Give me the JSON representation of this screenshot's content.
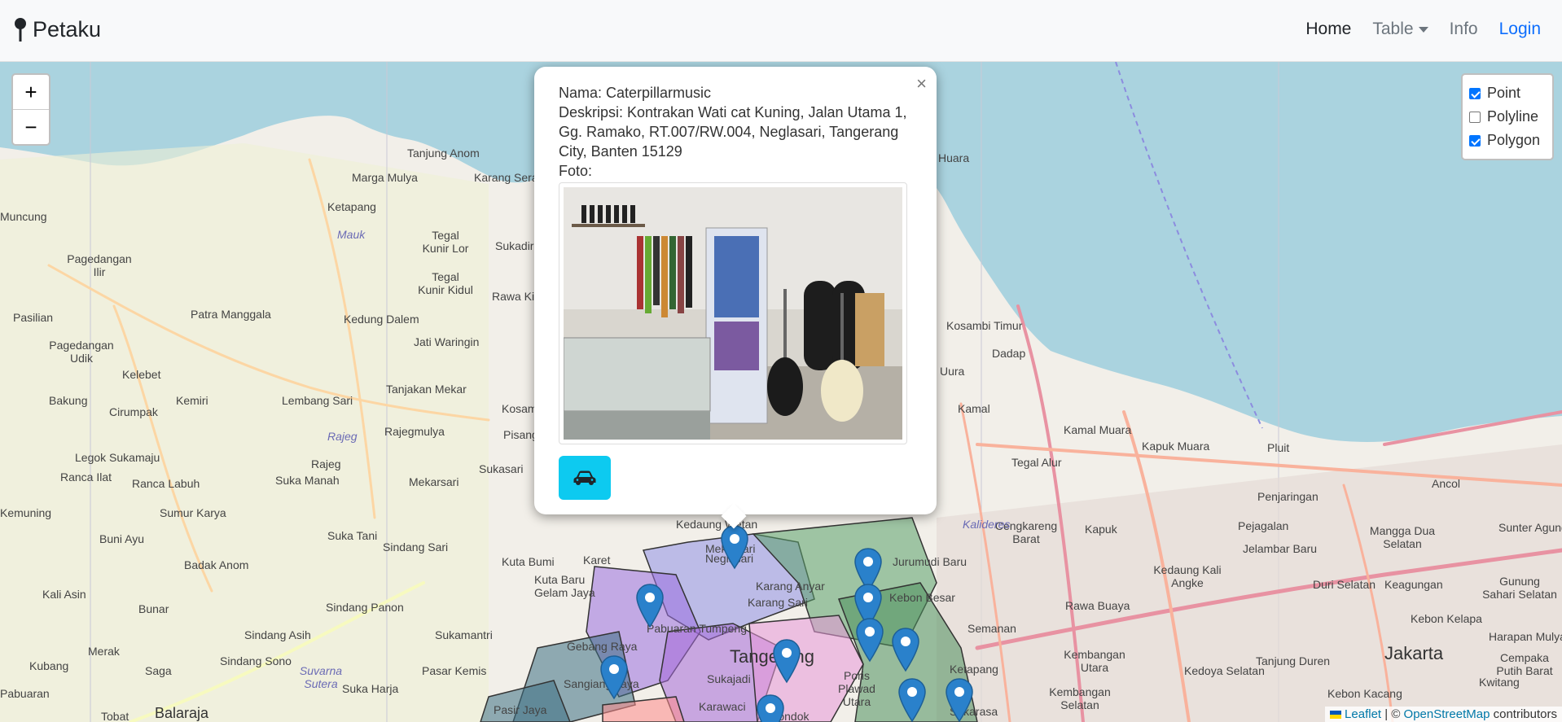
{
  "navbar": {
    "brand": "Petaku",
    "links": {
      "home": "Home",
      "table": "Table",
      "info": "Info",
      "login": "Login"
    }
  },
  "zoom": {
    "in": "+",
    "out": "−"
  },
  "layers": {
    "point": {
      "label": "Point",
      "checked": true
    },
    "polyline": {
      "label": "Polyline",
      "checked": false
    },
    "polygon": {
      "label": "Polygon",
      "checked": true
    }
  },
  "popup": {
    "close": "×",
    "nama": "Nama: Caterpillarmusic",
    "deskripsi": "Deskripsi: Kontrakan Wati cat Kuning, Jalan Utama 1, Gg. Ramako, RT.007/RW.004, Neglasari, Tangerang City, Banten 15129",
    "foto": "Foto:",
    "route_icon": "car-icon"
  },
  "places": [
    "Tanjung Anom",
    "Marga Mulya",
    "Karang Serang",
    "Ketapang",
    "Mauk",
    "Muncung",
    "Pagedangan Ilir",
    "Tegal Kunir Lor",
    "Tegal Kunir Kidul",
    "Sukadiri",
    "Rawa Kidang",
    "Pasilian",
    "Patra Manggala",
    "Kedung Dalem",
    "Jati Waringin",
    "Pagedangan Udik",
    "Kelebet",
    "Tanjakan Mekar",
    "Bakung",
    "Cirumpak",
    "Kemiri",
    "Lembang Sari",
    "Kosambi",
    "Rajeg",
    "Rajegmulya",
    "Pisangan",
    "Legok Sukamaju",
    "Rajeg",
    "Suka Manah",
    "Sukasari",
    "Ranca Ilat",
    "Ranca Labuh",
    "Mekarsari",
    "Kemuning",
    "Sumur Karya",
    "Buni Ayu",
    "Suka Tani",
    "Sindang Sari",
    "Badak Anom",
    "Kuta Bumi",
    "Kuta Baru",
    "Karet",
    "Kali Asin",
    "Bunar",
    "Sindang Panon",
    "Gelam Jaya",
    "Sindang Asih",
    "Sukamantri",
    "Merak",
    "Kubang",
    "Sindang Sono",
    "Pasar Kemis",
    "Saga",
    "Suvarna Sutera",
    "Suka Harja",
    "Pabuaran",
    "Tobat",
    "Balaraja",
    "Pasir Jaya",
    "Kosambi Timur",
    "Dadap",
    "Kamal",
    "Kamal Muara",
    "Tegal Alur",
    "Kapuk Muara",
    "Pluit",
    "Ancol",
    "Cengkareng Barat",
    "Kapuk",
    "Penjaringan",
    "Pejagalan",
    "Jelambar Baru",
    "Mangga Dua Selatan",
    "Sunter Agung",
    "Kedaung Kali Angke",
    "Duri Selatan",
    "Keagungan",
    "Gunung Sahari Selatan",
    "Kebon Kelapa",
    "Harapan Mulya",
    "Jakarta",
    "Cempaka Putih Barat",
    "Kwitang",
    "Tanjung Duren",
    "Kebon Kacang",
    "Kedoya Selatan",
    "Kembangan Utara",
    "Kembangan Selatan",
    "Rawa Buaya",
    "Semanan",
    "Jurumudi Baru",
    "Kebon Besar",
    "Karang Anyar",
    "Karang Sari",
    "Kedaung Wetan",
    "Neglasari",
    "Gebang Raya",
    "Pabuaran Tumpeng",
    "Tangerang",
    "Sukajadi",
    "Poris Plawad Utara",
    "Sangiang Jaya",
    "Karawaci",
    "Ketapang",
    "Kalideres",
    "Mekarsari",
    "Sukarasa",
    "Pondok",
    "Huara",
    "Uura"
  ],
  "attribution": {
    "leaflet": "Leaflet",
    "sep": " | © ",
    "osm": "OpenStreetMap",
    "rest": " contributors"
  }
}
